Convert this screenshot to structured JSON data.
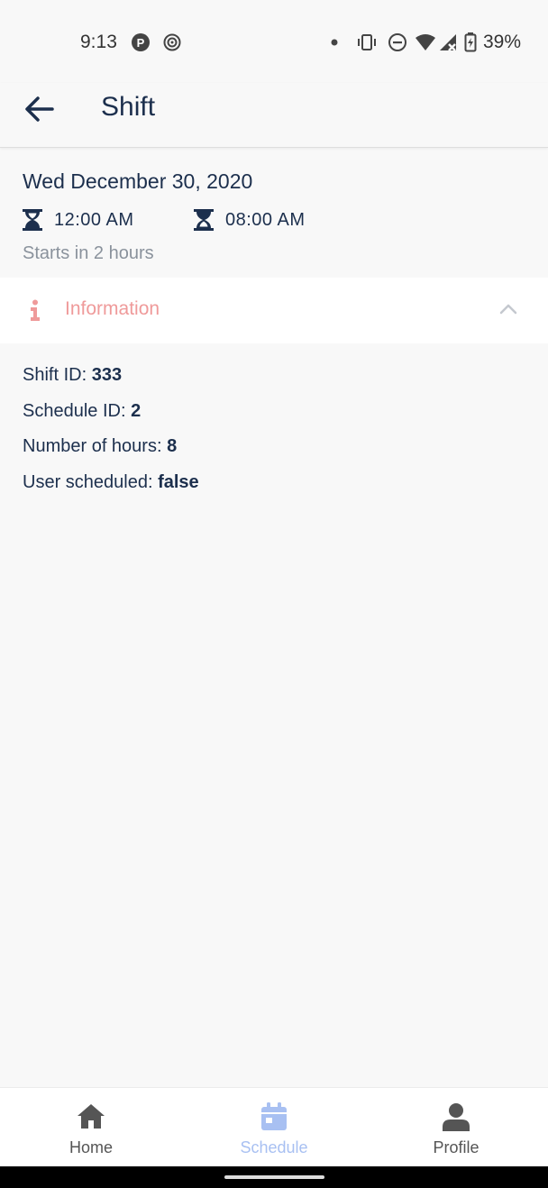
{
  "status_bar": {
    "time": "9:13",
    "battery": "39%"
  },
  "app_bar": {
    "title": "Shift"
  },
  "shift": {
    "date": "Wed December 30, 2020",
    "start_time": "12:00 AM",
    "end_time": "08:00 AM",
    "starts_in": "Starts in 2 hours"
  },
  "info_section": {
    "title": "Information",
    "rows": [
      {
        "label": "Shift ID: ",
        "value": "333"
      },
      {
        "label": "Schedule ID: ",
        "value": "2"
      },
      {
        "label": "Number of hours: ",
        "value": "8"
      },
      {
        "label": "User scheduled: ",
        "value": "false"
      }
    ]
  },
  "bottom_nav": {
    "items": [
      {
        "label": "Home",
        "icon": "home-icon"
      },
      {
        "label": "Schedule",
        "icon": "calendar-icon",
        "active": true
      },
      {
        "label": "Profile",
        "icon": "person-icon"
      }
    ]
  },
  "colors": {
    "primary": "#1c2f4d",
    "info_accent": "#ef9a9a",
    "active_nav": "#a8c0f2"
  }
}
